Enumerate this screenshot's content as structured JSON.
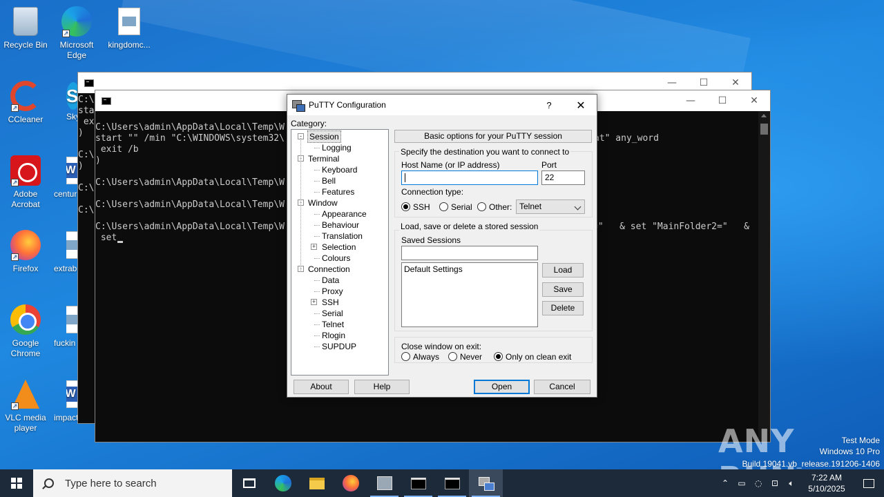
{
  "desktop": {
    "icons": [
      {
        "label": "Recycle Bin",
        "icon": "recycle-bin-icon"
      },
      {
        "label": "Microsoft Edge",
        "icon": "edge-icon"
      },
      {
        "label": "kingdomc...",
        "icon": "image-file-icon"
      },
      {
        "label": "CCleaner",
        "icon": "ccleaner-icon"
      },
      {
        "label": "Skyp",
        "icon": "skype-icon"
      },
      {
        "label": "Adobe Acrobat",
        "icon": "acrobat-icon"
      },
      {
        "label": "centur",
        "icon": "word-doc-icon"
      },
      {
        "label": "Firefox",
        "icon": "firefox-icon"
      },
      {
        "label": "extrab",
        "icon": "image-file-icon"
      },
      {
        "label": "Google Chrome",
        "icon": "chrome-icon"
      },
      {
        "label": "fuckin",
        "icon": "image-file-icon"
      },
      {
        "label": "VLC media player",
        "icon": "vlc-icon"
      },
      {
        "label": "impact",
        "icon": "word-doc-icon"
      }
    ]
  },
  "back_terminal": {
    "lines": [
      "C:\\",
      "sta",
      " ex",
      ")",
      "",
      "C:\\",
      ")",
      "",
      "C:\\",
      "",
      "C:\\"
    ]
  },
  "front_terminal": {
    "lines": [
      "C:\\Users\\admin\\AppData\\Local\\Temp\\W",
      "start \"\" /min \"C:\\WINDOWS\\system32\\",
      " exit /b",
      ")",
      "",
      "C:\\Users\\admin\\AppData\\Local\\Temp\\W",
      "",
      "C:\\Users\\admin\\AppData\\Local\\Temp\\W",
      "",
      "C:\\Users\\admin\\AppData\\Local\\Temp\\W",
      " set"
    ],
    "right_line1": "at\" any_word",
    "right_line2": "=\"   & set \"MainFolder2=\"   &"
  },
  "putty": {
    "title": "PuTTY Configuration",
    "help": "?",
    "category_label": "Category:",
    "tree": [
      {
        "label": "Session",
        "level": 0,
        "expander": "-"
      },
      {
        "label": "Logging",
        "level": 1
      },
      {
        "label": "Terminal",
        "level": 0,
        "expander": "-"
      },
      {
        "label": "Keyboard",
        "level": 1
      },
      {
        "label": "Bell",
        "level": 1
      },
      {
        "label": "Features",
        "level": 1
      },
      {
        "label": "Window",
        "level": 0,
        "expander": "-"
      },
      {
        "label": "Appearance",
        "level": 1
      },
      {
        "label": "Behaviour",
        "level": 1
      },
      {
        "label": "Translation",
        "level": 1
      },
      {
        "label": "Selection",
        "level": 1,
        "expander": "+"
      },
      {
        "label": "Colours",
        "level": 1
      },
      {
        "label": "Connection",
        "level": 0,
        "expander": "-"
      },
      {
        "label": "Data",
        "level": 1
      },
      {
        "label": "Proxy",
        "level": 1
      },
      {
        "label": "SSH",
        "level": 1,
        "expander": "+"
      },
      {
        "label": "Serial",
        "level": 1
      },
      {
        "label": "Telnet",
        "level": 1
      },
      {
        "label": "Rlogin",
        "level": 1
      },
      {
        "label": "SUPDUP",
        "level": 1
      }
    ],
    "header": "Basic options for your PuTTY session",
    "dest_label": "Specify the destination you want to connect to",
    "host_label": "Host Name (or IP address)",
    "host_value": "",
    "port_label": "Port",
    "port_value": "22",
    "conn_type_label": "Connection type:",
    "conn_ssh": "SSH",
    "conn_serial": "Serial",
    "conn_other": "Other:",
    "other_select": "Telnet",
    "sessions_group": "Load, save or delete a stored session",
    "saved_label": "Saved Sessions",
    "saved_value": "",
    "sessions_list": [
      "Default Settings"
    ],
    "load": "Load",
    "save": "Save",
    "delete": "Delete",
    "close_label": "Close window on exit:",
    "close_always": "Always",
    "close_never": "Never",
    "close_clean": "Only on clean exit",
    "about": "About",
    "help_btn": "Help",
    "open": "Open",
    "cancel": "Cancel"
  },
  "watermark": {
    "brand": "ANY RUN",
    "line1": "Test Mode",
    "line2": "Windows 10 Pro",
    "line3": "Build 19041.vb_release.191206-1406"
  },
  "taskbar": {
    "search_placeholder": "Type here to search",
    "time": "7:22 AM",
    "date": "5/10/2025"
  }
}
